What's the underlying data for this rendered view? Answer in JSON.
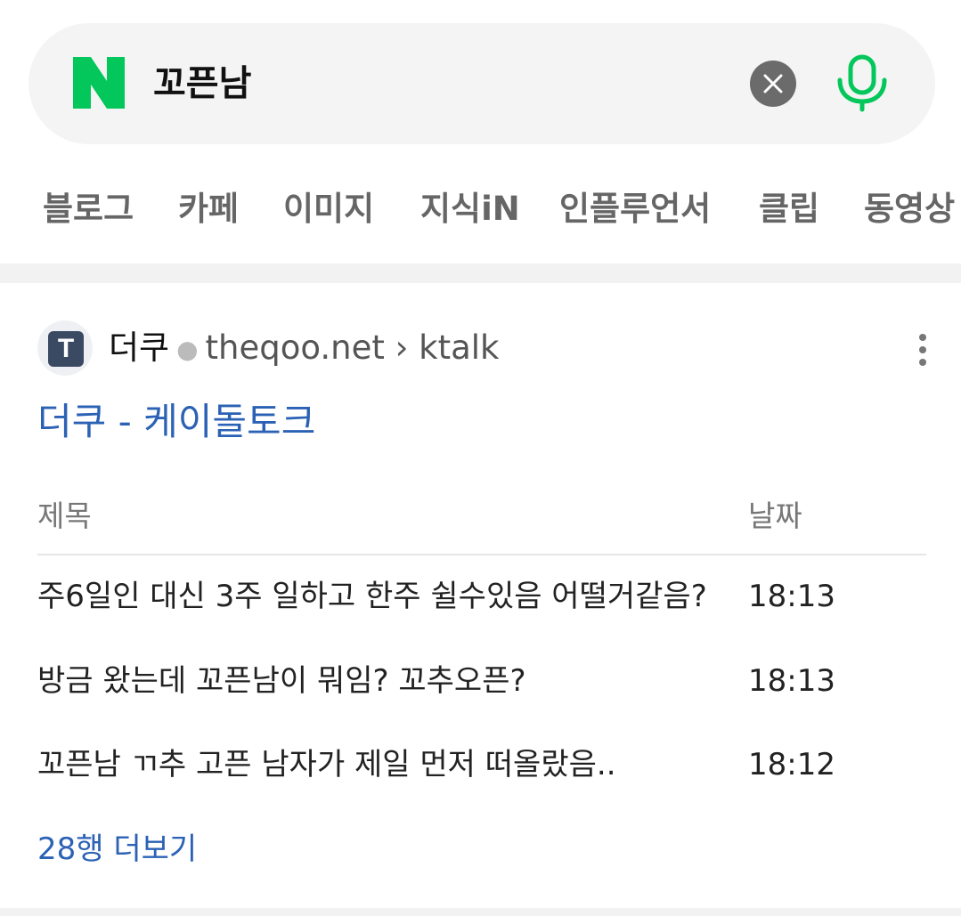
{
  "search": {
    "query": "꼬픈남",
    "brand_color": "#03c75a"
  },
  "tabs": [
    {
      "label": "블로그"
    },
    {
      "label": "카페"
    },
    {
      "label": "이미지"
    },
    {
      "label": "지식iN"
    },
    {
      "label": "인플루언서"
    },
    {
      "label": "클립"
    },
    {
      "label": "동영상"
    }
  ],
  "result": {
    "source_icon_letter": "T",
    "source_name": "더쿠",
    "source_url": "theqoo.net › ktalk",
    "title": "더쿠 - 케이돌토크",
    "table": {
      "headers": {
        "title": "제목",
        "date": "날짜"
      },
      "rows": [
        {
          "title": "주6일인 대신 3주 일하고 한주 쉴수있음 어떨거같음?",
          "date": "18:13"
        },
        {
          "title": "방금 왔는데 꼬픈남이 뭐임? 꼬추오픈?",
          "date": "18:13"
        },
        {
          "title": "꼬픈남 ㄲ추 고픈 남자가 제일 먼저 떠올랐음..",
          "date": "18:12"
        }
      ]
    },
    "more_link": "28행 더보기",
    "link_color": "#2b62b5"
  }
}
